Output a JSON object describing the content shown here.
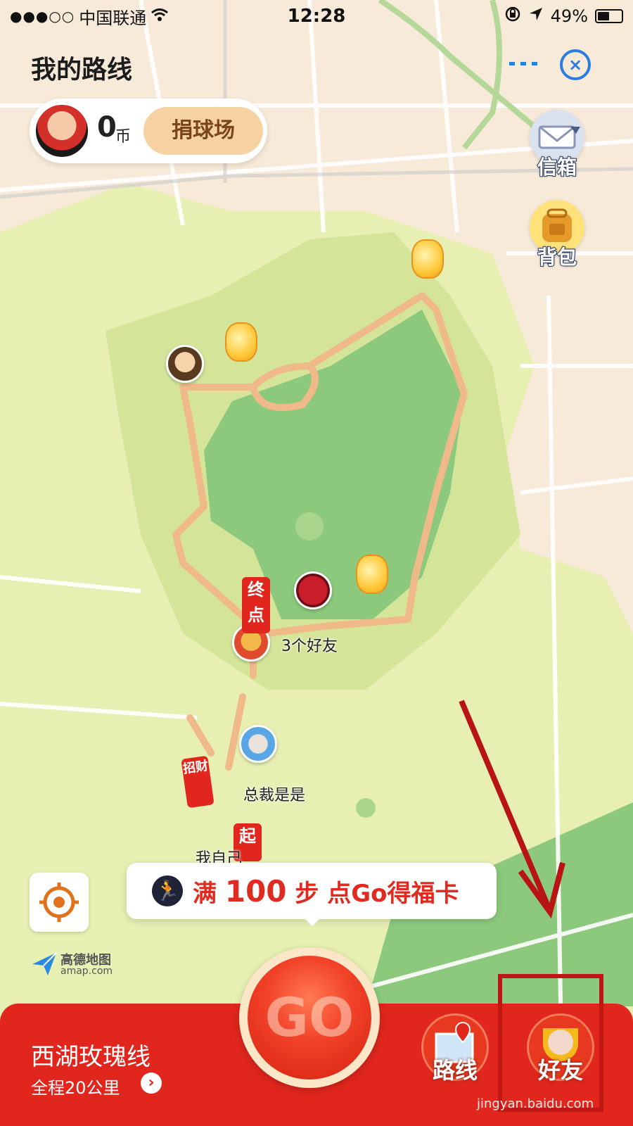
{
  "status_bar": {
    "signal_dots": "●●●○○",
    "carrier": "中国联通",
    "time": "12:28",
    "battery_percent": "49%"
  },
  "header": {
    "title": "我的路线",
    "more_icon": "ellipsis-icon",
    "close_icon": "close-circle-icon"
  },
  "coin_card": {
    "coins": "0",
    "unit": "币",
    "donate_label": "捐球场"
  },
  "side_buttons": {
    "mailbox_label": "信箱",
    "backpack_label": "背包"
  },
  "map": {
    "end_flag": "终点",
    "start_flag": "起",
    "friends_label": "3个好友",
    "friend_name": "总裁是是",
    "self_label": "我自己",
    "gate_sign": "招财",
    "amap_logo_cn": "高德地图",
    "amap_logo_en": "amap.com"
  },
  "tip": {
    "prefix": "满",
    "steps": "100",
    "suffix": "步 点Go得福卡"
  },
  "bottom_bar": {
    "route_name": "西湖玫瑰线",
    "route_distance": "全程20公里",
    "go_label": "GO",
    "route_button": "路线",
    "friends_button": "好友"
  },
  "watermark": "jingyan.baidu.com",
  "colors": {
    "brand_red": "#e0261d",
    "route_path": "#f0b98a",
    "accent_blue": "#2a7de0",
    "annotation_red": "#c01616"
  }
}
